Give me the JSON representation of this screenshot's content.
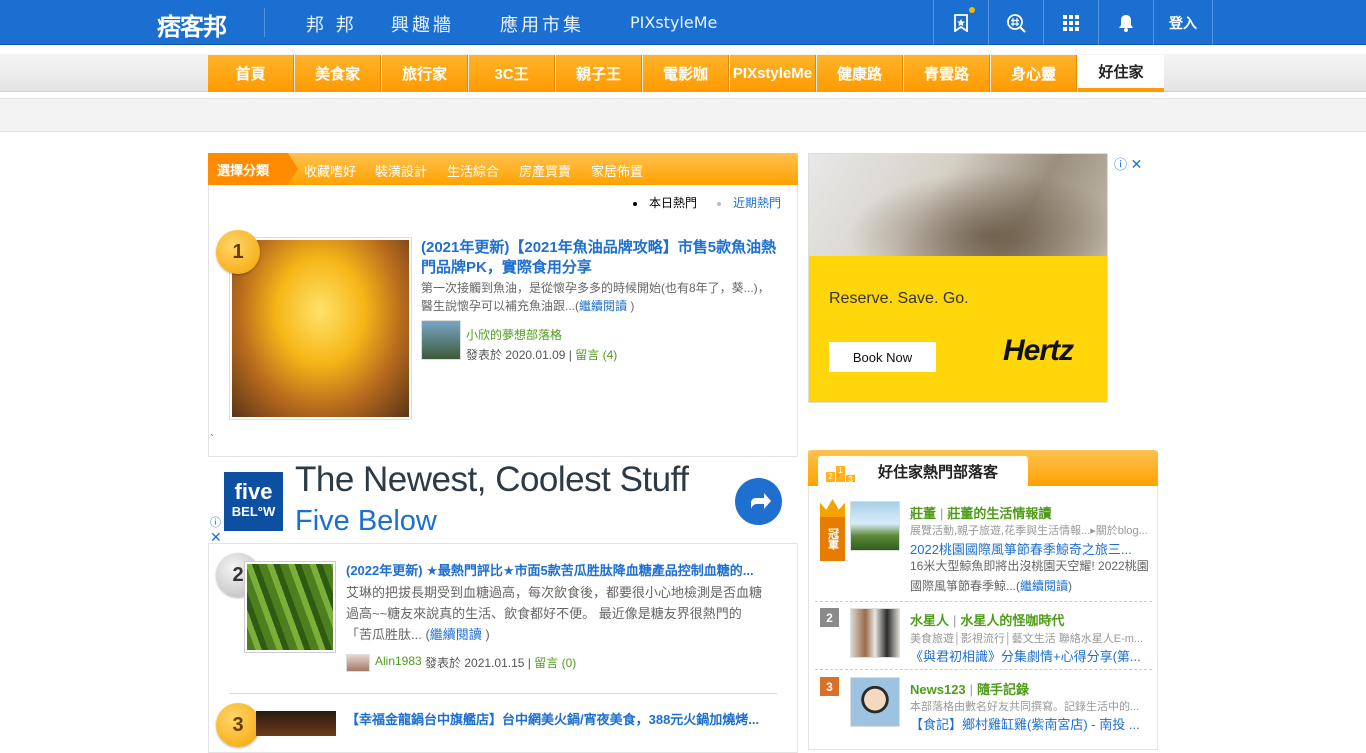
{
  "topbar": {
    "logo": "痞客邦",
    "nav": [
      "邦 邦",
      "興趣牆",
      "應用市集",
      "PIXstyleMe"
    ],
    "icons": [
      "bookmark-icon",
      "hashtag-search-icon",
      "apps-grid-icon",
      "bell-icon"
    ],
    "login": "登入"
  },
  "categories": [
    "首頁",
    "美食家",
    "旅行家",
    "3C王",
    "親子王",
    "電影咖",
    "PIXstyleMe",
    "健康路",
    "青雲路",
    "身心靈",
    "好住家"
  ],
  "filter": {
    "label": "選擇分類",
    "items": [
      "收藏嗜好",
      "裝潢設計",
      "生活綜合",
      "房產買賣",
      "家居佈置"
    ]
  },
  "hot_switch": {
    "today": "本日熱門",
    "recent": "近期熱門"
  },
  "posts": [
    {
      "rank": "1",
      "title": "(2021年更新)【2021年魚油品牌攻略】市售5款魚油熱門品牌PK，實際食用分享",
      "excerpt": "第一次接觸到魚油，是從懷孕多多的時候開始(也有8年了，葵...)，醫生說懷孕可以補充魚油跟...",
      "more": "繼續閱讀",
      "author": "小欣的夢想部落格",
      "published_prefix": "發表於",
      "date": "2020.01.09",
      "comments_label": "留言",
      "comments": "(4)"
    },
    {
      "rank": "2",
      "title": "(2022年更新) ★最熱門評比★市面5款苦瓜胜肽降血糖產品控制血糖的...",
      "excerpt": "艾琳的把拔長期受到血糖過高，每次飲食後，都要很小心地檢測是否血糖過高~~糖友來說真的生活、飲食都好不便。 最近像是糖友界很熱門的「苦瓜胜肽...",
      "more": "繼續閱讀",
      "author": "Alin1983",
      "published_prefix": "發表於",
      "date": "2021.01.15",
      "comments_label": "留言",
      "comments": "(0)"
    },
    {
      "rank": "3",
      "title": "【幸福金龍鍋台中旗艦店】台中網美火鍋/宵夜美食，388元火鍋加燒烤..."
    }
  ],
  "stray_mark": "`",
  "ad_fivebelow": {
    "logo_line1": "five",
    "logo_line2": "BEL°W",
    "headline": "The Newest, Coolest Stuff",
    "sub": "Five Below"
  },
  "ad_hertz": {
    "tagline": "Reserve. Save. Go.",
    "button": "Book Now",
    "logo": "Hertz"
  },
  "blogbox": {
    "title": "好住家熱門部落客",
    "crown_label": "冠軍",
    "blogs": [
      {
        "rank": "1",
        "author": "莊董",
        "blog": "莊董的生活情報讀",
        "tags": "展覽活動,親子旅遊,花季與生活情報...▸關於blog...",
        "post": "2022桃園國際風箏節春季鯨奇之旅三...",
        "desc": "16米大型鯨魚即將出沒桃園天空耀! 2022桃園國際風箏節春季鯨...(",
        "more": "繼續閱讀",
        "close": ")"
      },
      {
        "rank": "2",
        "author": "水星人",
        "blog": "水星人的怪咖時代",
        "tags": "美食旅遊│影視流行│藝文生活 聯絡水星人E-m...",
        "post": "《與君初相識》分集劇情+心得分享(第..."
      },
      {
        "rank": "3",
        "author": "News123",
        "blog": "隨手記錄",
        "tags": "本部落格由數名好友共同撰寫。記錄生活中的...",
        "post": "【食記】鄉村雞缸雞(紫南宮店) - 南投 ..."
      }
    ]
  },
  "colors": {
    "topbar": "#1a6fd0",
    "orange": "#ffa200",
    "link": "#1f6fd0",
    "green": "#4f9c1a"
  }
}
